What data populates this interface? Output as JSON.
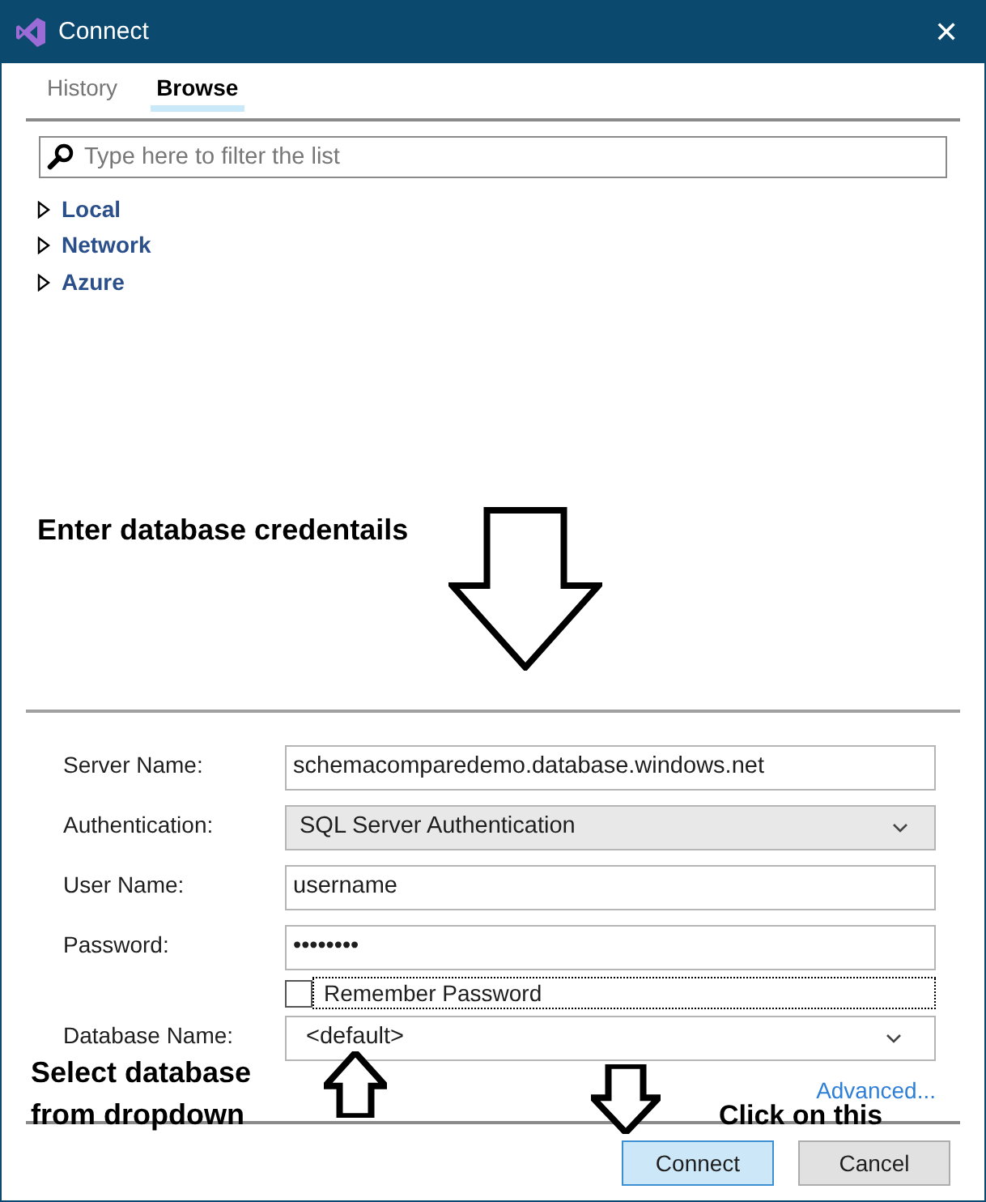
{
  "window": {
    "title": "Connect",
    "close": "✕"
  },
  "tabs": [
    {
      "label": "History",
      "selected": false
    },
    {
      "label": "Browse",
      "selected": true
    }
  ],
  "filter": {
    "placeholder": "Type here to filter the list"
  },
  "tree": [
    {
      "label": "Local",
      "expanded": false
    },
    {
      "label": "Network",
      "expanded": false
    },
    {
      "label": "Azure",
      "expanded": false
    }
  ],
  "form": [
    {
      "kind": "text",
      "label": "Server Name:",
      "value": "schemacomparedemo.database.windows.net"
    },
    {
      "kind": "dropdown",
      "label": "Authentication:",
      "value": "SQL Server Authentication",
      "disabled": true
    },
    {
      "kind": "text",
      "label": "User Name:",
      "value": "username"
    },
    {
      "kind": "text",
      "label": "Password:",
      "value": "••••••••"
    },
    {
      "kind": "checkbox",
      "label": "Remember Password",
      "checked": false
    },
    {
      "kind": "dropdown",
      "label": "Database Name:",
      "value": "<default>",
      "disabled": false
    }
  ],
  "advanced_link": "Advanced...",
  "buttons": [
    {
      "label": "Connect",
      "primary": true
    },
    {
      "label": "Cancel",
      "primary": false
    }
  ],
  "annotations": [
    "Enter database credentails",
    "Select database\nfrom dropdown",
    "Click on this"
  ]
}
